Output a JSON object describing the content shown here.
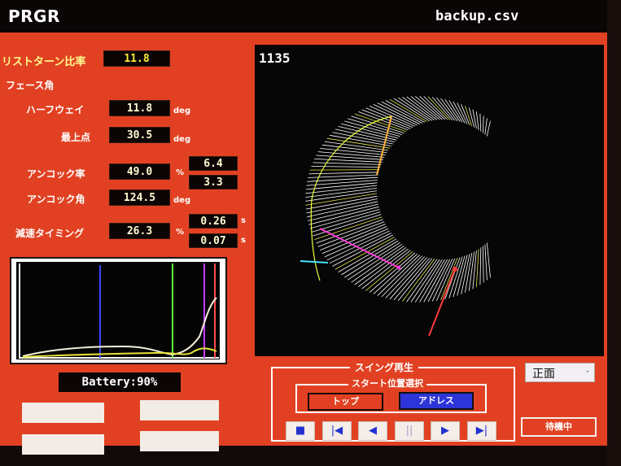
{
  "header": {
    "brand": "PRGR",
    "filename": "backup.csv"
  },
  "metrics": {
    "wrist_turn_ratio": {
      "label": "リストターン比率",
      "value": "11.8"
    },
    "face_angle_heading": "フェース角",
    "halfway": {
      "label": "ハーフウェイ",
      "value": "11.8",
      "unit": "deg"
    },
    "top_point": {
      "label": "最上点",
      "value": "30.5",
      "unit": "deg"
    },
    "uncock_rate": {
      "label": "アンコック率",
      "value": "49.0",
      "unit": "%",
      "sub1": "6.4",
      "sub2": "3.3"
    },
    "uncock_angle": {
      "label": "アンコック角",
      "value": "124.5",
      "unit": "deg"
    },
    "decel_timing": {
      "label": "減速タイミング",
      "value": "26.3",
      "unit": "%",
      "sub1": "0.26",
      "sub2": "0.07",
      "sub_unit": "s"
    }
  },
  "battery": {
    "text": "Battery:90%"
  },
  "viewer": {
    "frame": "1135"
  },
  "swing_playback": {
    "title": "スイング再生",
    "start_position": {
      "title": "スタート位置選択",
      "top_label": "トップ",
      "address_label": "アドレス",
      "selected": "address"
    },
    "controls": [
      "stop-icon",
      "skip-start-icon",
      "step-back-icon",
      "pause-icon",
      "step-forward-icon",
      "skip-end-icon"
    ]
  },
  "view_select": {
    "value": "正面"
  },
  "status_button": {
    "label": "待機中"
  },
  "colors": {
    "panel": "#e14122",
    "address_selected": "#2d35d8",
    "value_text": "#fffad0",
    "label_yellow": "#fffb8c"
  }
}
